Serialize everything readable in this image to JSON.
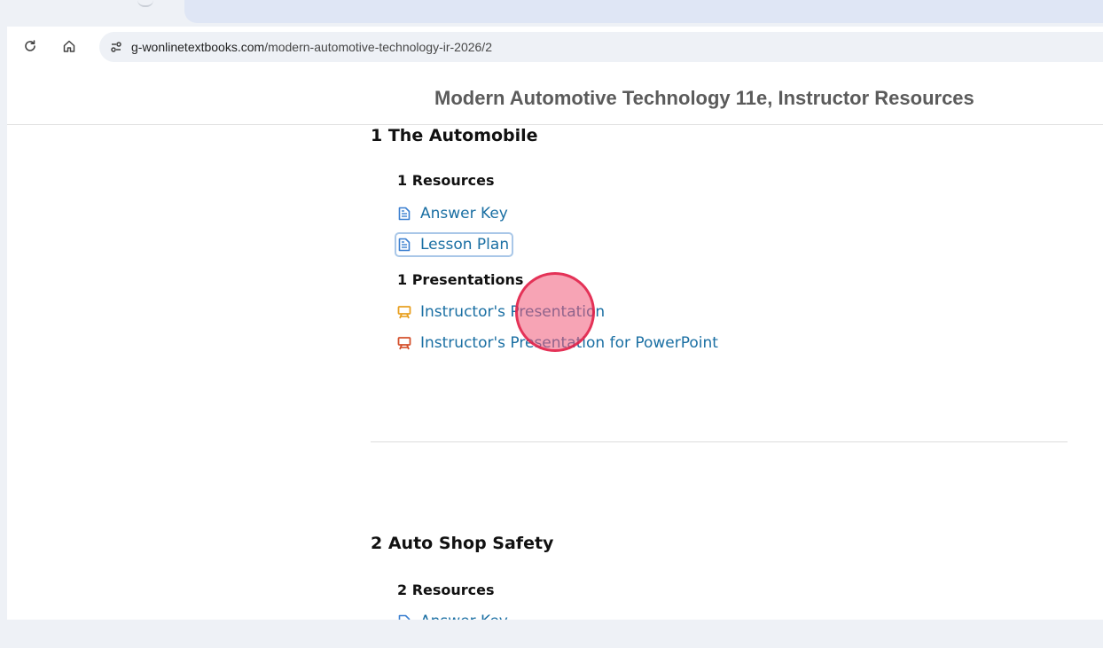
{
  "browser": {
    "url_domain": "g-wonlinetextbooks.com",
    "url_path": "/modern-automotive-technology-ir-2026/2",
    "reload_icon": "reload-icon",
    "home_icon": "home-icon",
    "site_info_icon": "site-info-icon"
  },
  "page": {
    "site_title": "Modern Automotive Technology 11e, Instructor Resources",
    "chapters": [
      {
        "title": "1 The Automobile",
        "resources_heading": "1 Resources",
        "resources": [
          {
            "label": "Answer Key",
            "icon": "document-icon"
          },
          {
            "label": "Lesson Plan",
            "icon": "document-icon"
          }
        ],
        "presentations_heading": "1 Presentations",
        "presentations": [
          {
            "label": "Instructor's Presentation",
            "icon": "presentation-icon"
          },
          {
            "label": "Instructor's Presentation for PowerPoint",
            "icon": "powerpoint-presentation-icon"
          }
        ]
      },
      {
        "title": "2 Auto Shop Safety",
        "resources_heading": "2 Resources",
        "resources": [
          {
            "label": "Answer Key",
            "icon": "document-icon"
          }
        ]
      }
    ]
  },
  "colors": {
    "link": "#1a6fa3",
    "document_icon": "#3a7fd0",
    "presentation_icon": "#e8a020",
    "powerpoint_icon": "#d4502c",
    "click_marker": "#e8506f"
  }
}
